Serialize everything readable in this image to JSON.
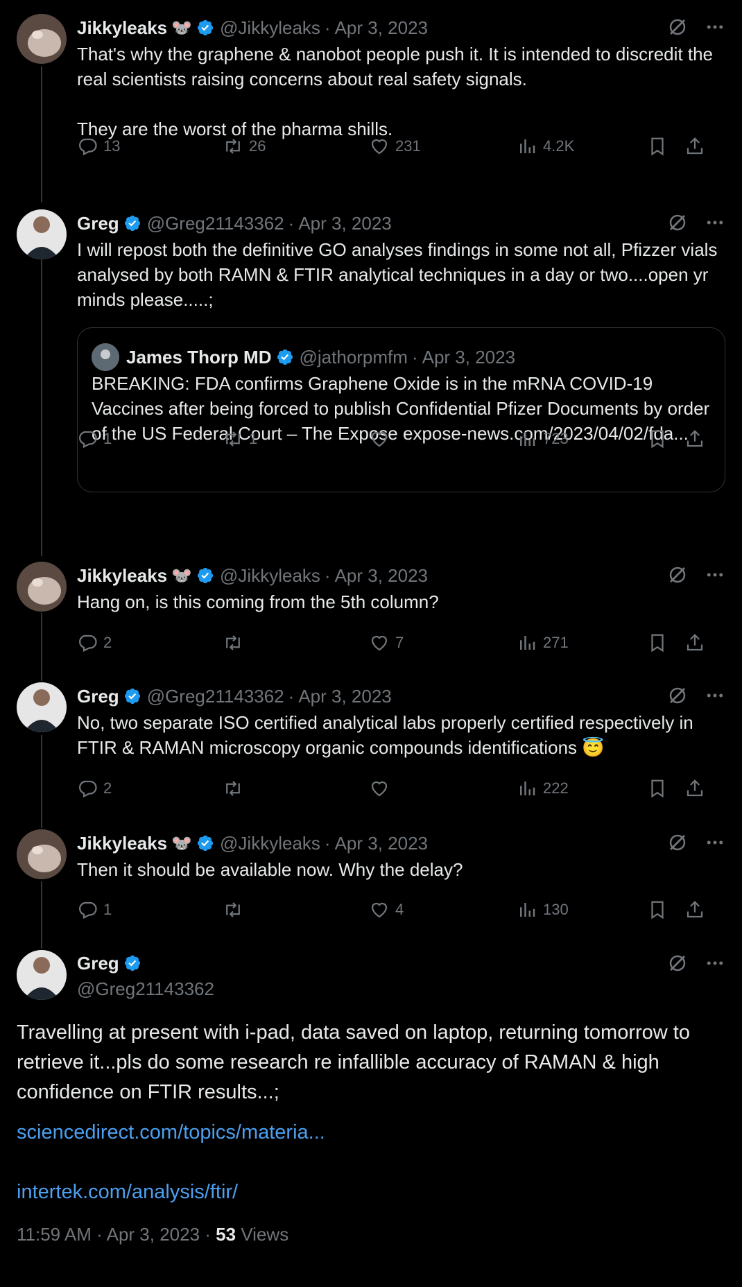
{
  "tweets": [
    {
      "name": "Jikkyleaks",
      "mouse": "🐭",
      "handle": "@Jikkyleaks",
      "date": "Apr 3, 2023",
      "text": "That's why the graphene & nanobot people push it. It is intended to discredit the real scientists raising concerns about real safety signals.\n\nThey are the worst of the pharma shills.",
      "replies": "13",
      "retweets": "26",
      "likes": "231",
      "views": "4.2K"
    },
    {
      "name": "Greg",
      "handle": "@Greg21143362",
      "date": "Apr 3, 2023",
      "text": "I will repost both the definitive GO analyses findings in some not all, Pfizzer vials analysed by both RAMN & FTIR analytical techniques in a day or two....open yr minds please.....;",
      "quote": {
        "name": "James Thorp MD",
        "handle": "@jathorpmfm",
        "date": "Apr 3, 2023",
        "text": "BREAKING: FDA confirms Graphene Oxide is in the mRNA COVID-19 Vaccines after being forced to publish Confidential Pfizer Documents by order of the US Federal Court – The Expose expose-news.com/2023/04/02/fda..."
      },
      "replies": "1",
      "retweets": "1",
      "likes": "",
      "views": "723"
    },
    {
      "name": "Jikkyleaks",
      "mouse": "🐭",
      "handle": "@Jikkyleaks",
      "date": "Apr 3, 2023",
      "text": "Hang on, is this coming from the 5th column?",
      "replies": "2",
      "retweets": "",
      "likes": "7",
      "views": "271"
    },
    {
      "name": "Greg",
      "handle": "@Greg21143362",
      "date": "Apr 3, 2023",
      "text": "No, two separate ISO certified analytical labs properly certified respectively in FTIR & RAMAN microscopy organic compounds identifications 😇",
      "replies": "2",
      "retweets": "",
      "likes": "",
      "views": "222"
    },
    {
      "name": "Jikkyleaks",
      "mouse": "🐭",
      "handle": "@Jikkyleaks",
      "date": "Apr 3, 2023",
      "text": "Then it should be available now. Why the delay?",
      "replies": "1",
      "retweets": "",
      "likes": "4",
      "views": "130"
    }
  ],
  "main": {
    "name": "Greg",
    "handle": "@Greg21143362",
    "text": "Travelling at present with i-pad, data saved on laptop, returning tomorrow to retrieve it...pls do some research re infallible accuracy of RAMAN & high confidence on FTIR results...;",
    "link1": "sciencedirect.com/topics/materia...",
    "link2": "intertek.com/analysis/ftir/",
    "time": "11:59 AM",
    "date": "Apr 3, 2023",
    "views_count": "53",
    "views_label": "Views"
  },
  "colors": {
    "accent": "#1d9bf0",
    "link": "#4ba0f0",
    "muted": "#71767b",
    "background": "#000000"
  },
  "icons": [
    "verified-badge-icon",
    "grok-icon",
    "more-icon",
    "reply-icon",
    "retweet-icon",
    "like-icon",
    "views-icon",
    "bookmark-icon",
    "share-icon"
  ]
}
